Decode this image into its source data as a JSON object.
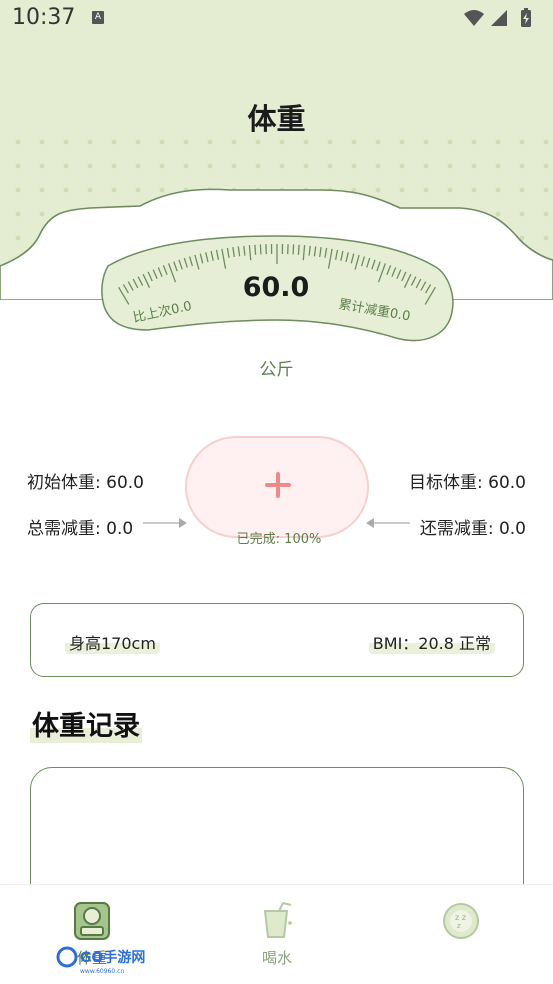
{
  "status_bar": {
    "time": "10:37",
    "notification_icon": "A"
  },
  "page": {
    "title": "体重"
  },
  "scale": {
    "current_weight": "60.0",
    "since_last": "比上次0.0",
    "total_lost": "累计减重0.0",
    "unit": "公斤"
  },
  "stats": {
    "initial_weight": "初始体重: 60.0",
    "target_weight": "目标体重: 60.0",
    "total_to_lose": "总需减重: 0.0",
    "remaining_to_lose": "还需减重: 0.0"
  },
  "add_button": {
    "complete_text": "已完成: 100%",
    "progress": 1.0
  },
  "bmi_card": {
    "height": "身高170cm",
    "bmi": "BMI：20.8 正常"
  },
  "records": {
    "title": "体重记录"
  },
  "nav": {
    "items": [
      {
        "label": "体重",
        "icon": "scale-icon",
        "active": true
      },
      {
        "label": "喝水",
        "icon": "water-cup-icon",
        "active": false
      },
      {
        "label": "",
        "icon": "sleep-icon",
        "active": false
      }
    ]
  },
  "watermark": {
    "text": "GO手游网",
    "sub": "www.60960.cn"
  },
  "colors": {
    "header_bg": "#e4edd2",
    "accent_green": "#5c7f4a",
    "border_green": "#6e8c5e",
    "pill_pink": "#fff1f1",
    "plus_pink": "#ee8a8c"
  }
}
